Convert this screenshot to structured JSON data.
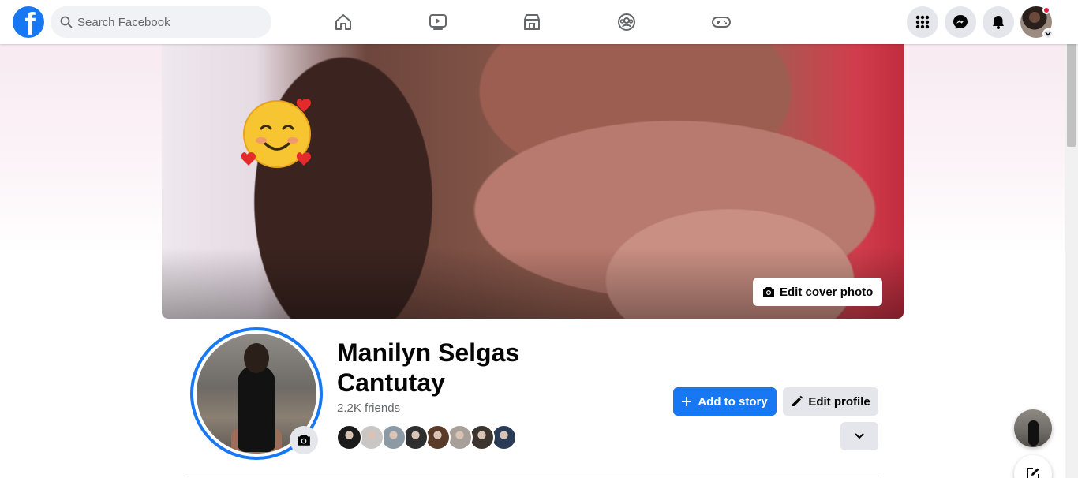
{
  "header": {
    "search_placeholder": "Search Facebook",
    "nav": [
      "home-icon",
      "watch-icon",
      "marketplace-icon",
      "groups-icon",
      "gaming-icon"
    ],
    "right_buttons": [
      "menu-grid-icon",
      "messenger-icon",
      "notifications-bell-icon"
    ]
  },
  "cover": {
    "edit_cover_label": "Edit cover photo"
  },
  "profile": {
    "name": "Manilyn Selgas Cantutay",
    "friends_count": "2.2K friends",
    "friend_avatar_colors": [
      "#1b1b1b",
      "#c9c6c4",
      "#8c9aa6",
      "#2e2e2e",
      "#5a3b2a",
      "#a8a098",
      "#3b342f",
      "#2a3b55"
    ]
  },
  "actions": {
    "add_story_label": "Add to story",
    "edit_profile_label": "Edit profile"
  },
  "colors": {
    "brand": "#1877f2",
    "secondary_button": "#e4e6eb"
  }
}
